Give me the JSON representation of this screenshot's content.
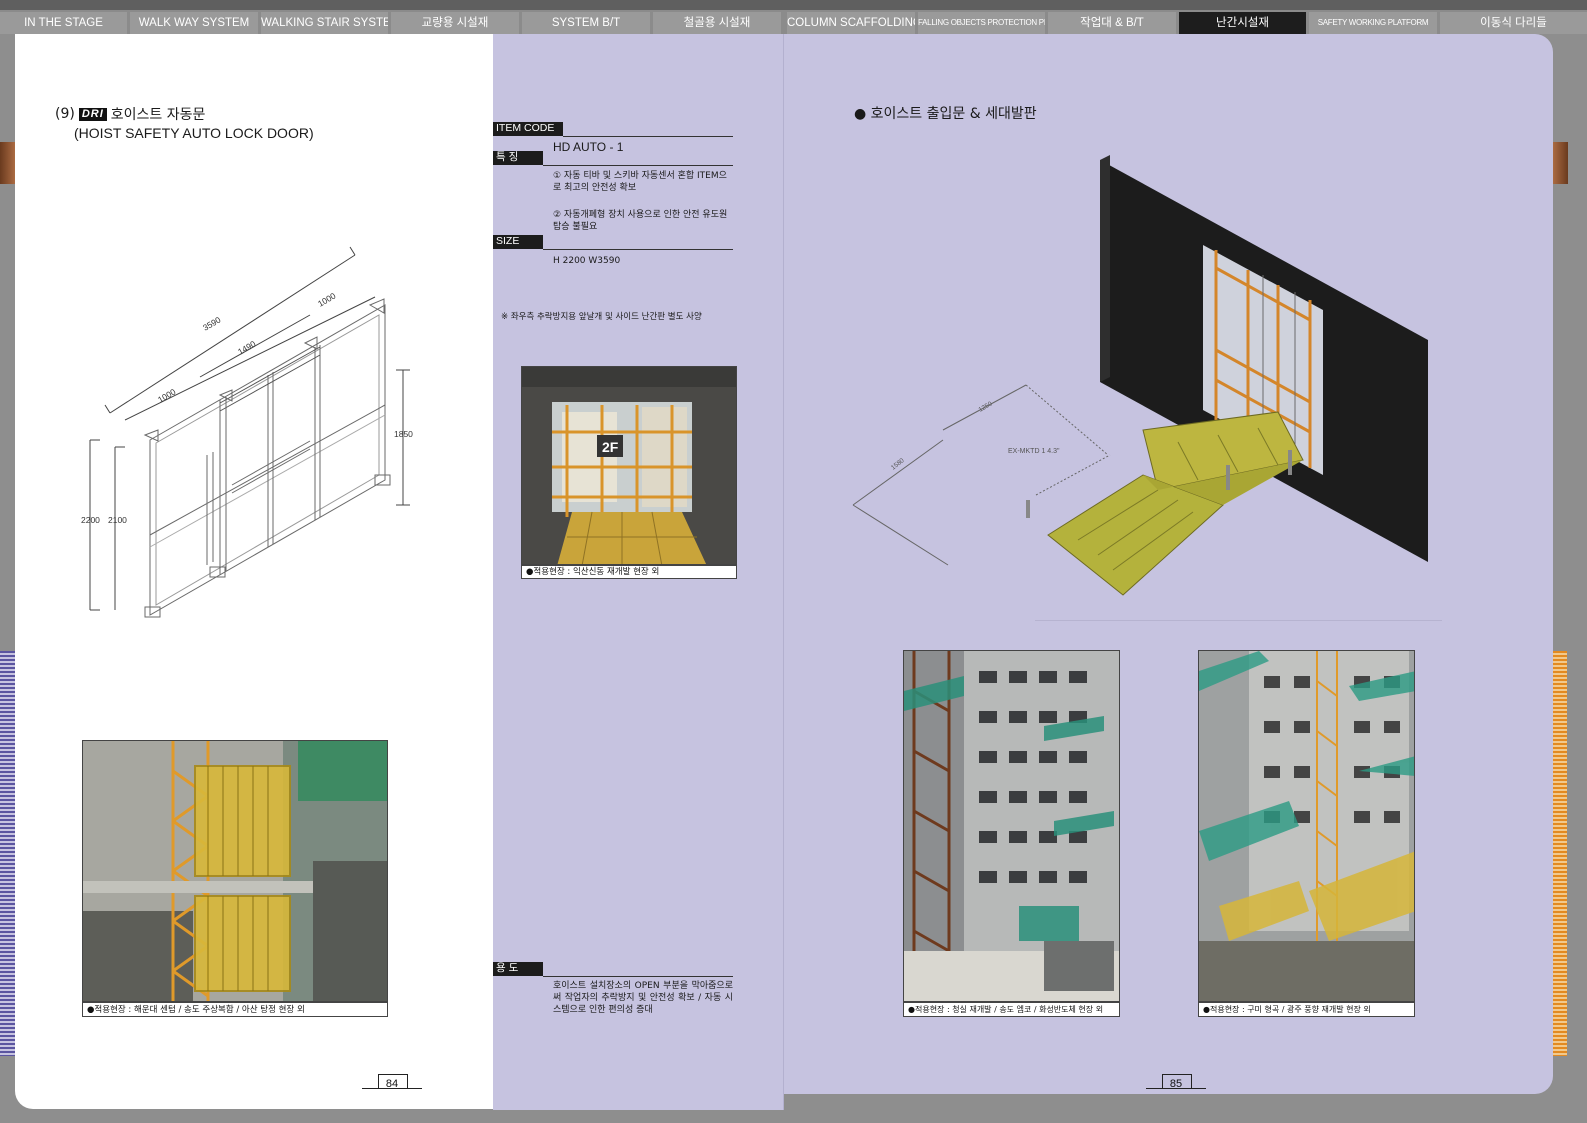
{
  "nav_tabs": [
    {
      "label": "IN THE STAGE"
    },
    {
      "label": "WALK WAY SYSTEM"
    },
    {
      "label": "WALKING STAIR SYSTEM"
    },
    {
      "label": "교량용 시설재"
    },
    {
      "label": "SYSTEM B/T"
    },
    {
      "label": "철골용 시설재"
    },
    {
      "label": "COLUMN SCAFFOLDING"
    },
    {
      "label": "FALLING OBJECTS PROTECTION PLATFORM"
    },
    {
      "label": "작업대 & B/T"
    },
    {
      "label": "난간시설재"
    },
    {
      "label": "SAFETY WORKING PLATFORM"
    },
    {
      "label": "이동식 다리들"
    }
  ],
  "left_page": {
    "number_prefix": "(9)",
    "logo_text": "DRI",
    "title_ko": "호이스트 자동문",
    "title_en": "(HOIST SAFETY AUTO LOCK DOOR)",
    "dimensions": {
      "total_width": "3590",
      "left_bay": "1000",
      "middle_bay": "1490",
      "right_bay": "1000",
      "height_outer": "2200",
      "height_inner": "2100",
      "door_height": "1850"
    },
    "photo_caption": "●적용현장 : 해운대 센텀 / 송도 주상복합 / 아산 탕정 현장 외",
    "page_number": "84"
  },
  "spec_panel": {
    "item_code_label": "ITEM CODE",
    "item_code_value": "HD AUTO - 1",
    "feature_label": "특 징",
    "feature_1": "① 자동 티바 및 스키바 자동센서 혼합 ITEM으로 최고의 안전성 확보",
    "feature_2": "② 자동개폐형 장치 사용으로 인한 안전 유도원 탑승 불필요",
    "size_label": "SIZE",
    "size_value": "H 2200  W3590",
    "note": "※ 좌우측 추락방지용 앞날개 및 사이드 난간판 별도 사양",
    "photo_label": "2F",
    "photo_caption": "●적용현장 : 익산신동 재개발 현장 외",
    "usage_label": "용 도",
    "usage_text": "호이스트 설치장소의 OPEN 부분을 막아줌으로써 작업자의 추락방지 및 안전성 확보 / 자동 시스템으로 인한 편의성 증대"
  },
  "right_page": {
    "heading": "● 호이스트 출입문 & 세대발판",
    "diagram_labels": {
      "dim_a": "1250",
      "dim_b": "1580",
      "model": "EX-MKTD 1 4.3\""
    },
    "photo_1_caption": "●적용현장 : 청실 재개발 / 송도 엠코 / 화성반도체 현장 외",
    "photo_2_caption": "●적용현장 : 구미 형곡 / 광주 풍향 재개발 현장 외",
    "page_number": "85"
  },
  "colors": {
    "tab_bg": "#9a9a9a",
    "tab_active": "#1d1d1d",
    "page_lavender": "#c6c3e0",
    "scaffold_orange": "#e09a2a",
    "door_yellow": "#e3c53a",
    "platform_olive": "#b4b23c"
  }
}
